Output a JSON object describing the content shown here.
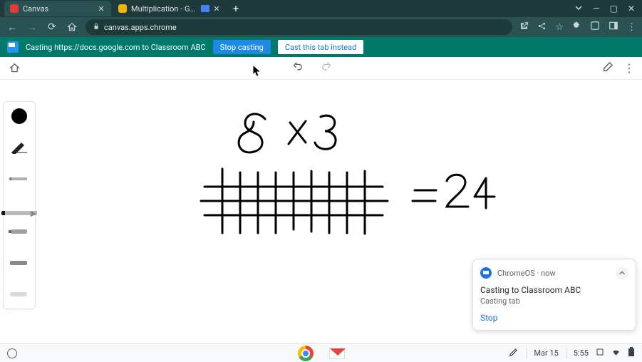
{
  "browser": {
    "tabs": [
      {
        "title": "Canvas",
        "favicon_color": "#e53935"
      },
      {
        "title": "Multiplication - Google Slid…",
        "favicon_color": "#f4b400"
      }
    ],
    "url": "canvas.apps.chrome"
  },
  "cast_bar": {
    "message": "Casting https://docs.google.com to Classroom ABC",
    "stop_label": "Stop casting",
    "cast_tab_label": "Cast this tab instead"
  },
  "canvas_app": {
    "tools": [
      "home",
      "undo",
      "redo",
      "eraser-outline",
      "more"
    ],
    "drawing": {
      "expression": "8 × 3",
      "result": "= 24"
    }
  },
  "notification": {
    "source": "ChromeOS",
    "time": "now",
    "title": "Casting to Classroom ABC",
    "subtitle": "Casting tab",
    "action": "Stop"
  },
  "shelf": {
    "date": "Mar 15",
    "time": "5:55"
  }
}
